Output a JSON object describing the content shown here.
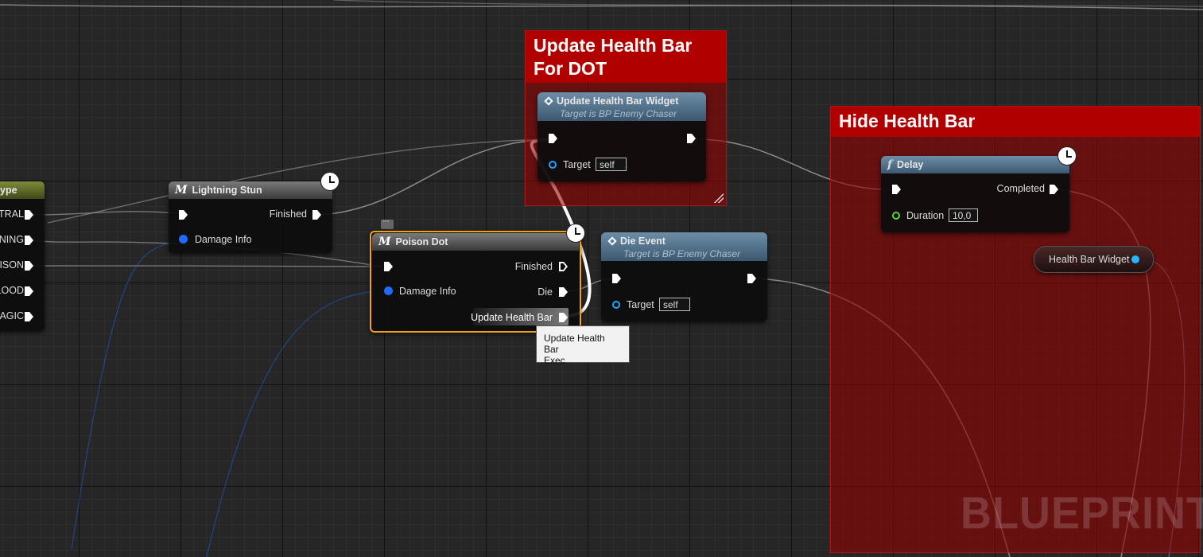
{
  "comments": {
    "update_health_bar": {
      "title": "Update Health Bar\nFor DOT"
    },
    "hide_health_bar": {
      "title": "Hide Health Bar"
    }
  },
  "enum_node": {
    "title": "ype",
    "outputs": [
      "TRAL",
      "NING",
      "ISON",
      "LOOD",
      "AGIC"
    ]
  },
  "lightning_stun": {
    "title": "Lightning Stun",
    "finished": "Finished",
    "damage_info": "Damage Info"
  },
  "poison_dot": {
    "title": "Poison Dot",
    "finished": "Finished",
    "damage_info": "Damage Info",
    "die": "Die",
    "update_health_bar": "Update Health Bar"
  },
  "update_widget": {
    "title": "Update Health Bar Widget",
    "subtitle": "Target is BP Enemy Chaser",
    "target": "Target",
    "target_value": "self"
  },
  "die_event": {
    "title": "Die Event",
    "subtitle": "Target is BP Enemy Chaser",
    "target": "Target",
    "target_value": "self"
  },
  "delay": {
    "title": "Delay",
    "completed": "Completed",
    "duration": "Duration",
    "duration_value": "10,0"
  },
  "health_bar_widget": {
    "label": "Health Bar Widget"
  },
  "tooltip": {
    "line1": "Update Health Bar",
    "line2": "Exec"
  },
  "watermark": "BLUEPRINT",
  "colors": {
    "comment_title": "#b00000",
    "selection": "#f0a317",
    "object_pin": "#1e6bff",
    "float_pin": "#5fd43c",
    "exec": "#ffffff"
  }
}
